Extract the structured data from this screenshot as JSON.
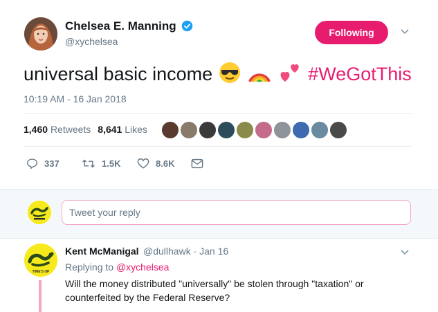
{
  "tweet": {
    "author_name": "Chelsea E. Manning",
    "author_handle": "@xychelsea",
    "follow_label": "Following",
    "text": "universal basic income",
    "hashtag": "#WeGotThis",
    "timestamp": "10:19 AM - 16 Jan 2018",
    "retweets_count": "1,460",
    "retweets_label": "Retweets",
    "likes_count": "8,641",
    "likes_label": "Likes",
    "replies_action": "337",
    "retweets_action": "1.5K",
    "likes_action": "8.6K",
    "emojis": [
      "sunglasses-emoji",
      "rainbow-emoji",
      "two-hearts-emoji"
    ]
  },
  "reply_box": {
    "placeholder": "Tweet your reply"
  },
  "reply": {
    "author_name": "Kent McManigal",
    "author_handle": "@dullhawk",
    "date": "· Jan 16",
    "replying_prefix": "Replying to",
    "replying_to": "@xychelsea",
    "text": "Will the money distributed \"universally\" be stolen through \"taxation\" or counterfeited by the Federal Reserve?",
    "avatar_text": "TIME'S UP"
  },
  "colors": {
    "accent": "#e81c6f",
    "muted": "#657786",
    "verified": "#1da1f2"
  }
}
